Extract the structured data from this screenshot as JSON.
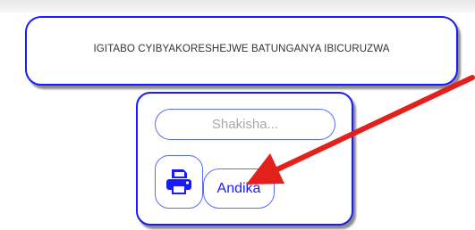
{
  "header": {
    "title": "IGITABO CYIBYAKORESHEJWE BATUNGANYA IBICURUZWA"
  },
  "search": {
    "placeholder": "Shakisha..."
  },
  "actions": {
    "print_icon": "printer-icon",
    "andika_label": "Andika"
  },
  "annotation": {
    "arrow_color": "#e3211c"
  },
  "colors": {
    "border": "#1a1aff",
    "input_border": "#5a6cff",
    "button_text": "#1a1aff"
  }
}
